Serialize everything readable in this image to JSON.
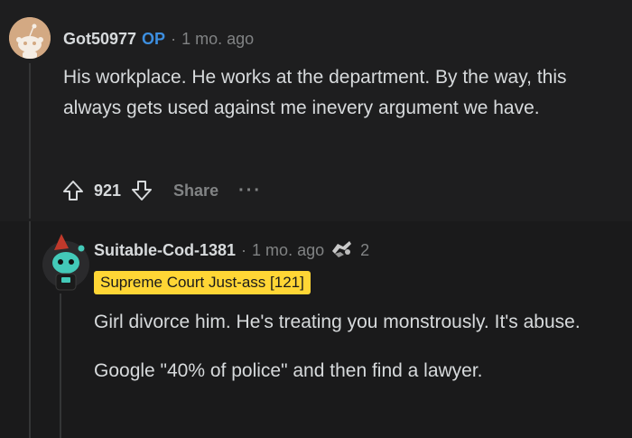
{
  "top_comment": {
    "username": "Got50977",
    "op_label": "OP",
    "separator": "·",
    "time": "1 mo. ago",
    "body": "His workplace. He works at the department. By the way, this always gets used against me inevery argument we have.",
    "score": "921",
    "share_label": "Share",
    "more_label": "···"
  },
  "reply": {
    "username": "Suitable-Cod-1381",
    "separator": "·",
    "time": "1 mo. ago",
    "award_count": "2",
    "flair": "Supreme Court Just-ass [121]",
    "paragraphs": [
      "Girl divorce him. He's treating you monstrously. It's abuse.",
      "Google \"40% of police\" and then find a lawyer."
    ]
  },
  "colors": {
    "background": "#1a1a1b",
    "text": "#d7dadc",
    "muted": "#818384",
    "op_blue": "#3d8fe0",
    "flair_yellow": "#ffd635"
  }
}
